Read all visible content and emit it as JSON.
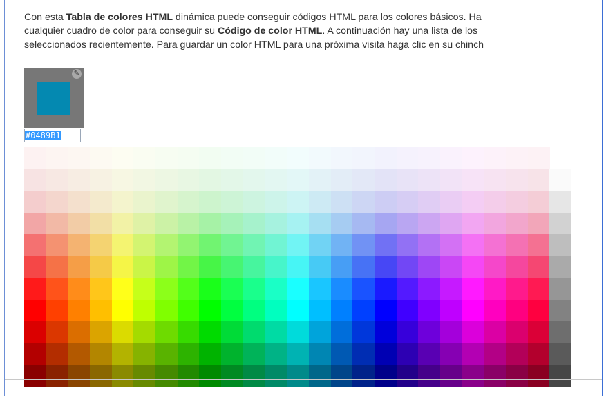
{
  "intro": {
    "line1": [
      "Con esta ",
      "Tabla de colores HTML",
      " dinámica puede conseguir códigos HTML para los colores básicos. Ha"
    ],
    "line2": [
      "cualquier cuadro de color para conseguir su ",
      "Código de color HTML",
      ". A continuación hay una lista de los"
    ],
    "line3": "seleccionados recientemente. Para guardar un color HTML para una próxima visita haga clic en su chinch"
  },
  "selected_color": {
    "hex": "#0489B1",
    "swatch_color": "#0489B1",
    "pin_icon": "pin-icon"
  },
  "palette": {
    "hue_columns": 24,
    "rows": 11,
    "gray_column": true
  }
}
